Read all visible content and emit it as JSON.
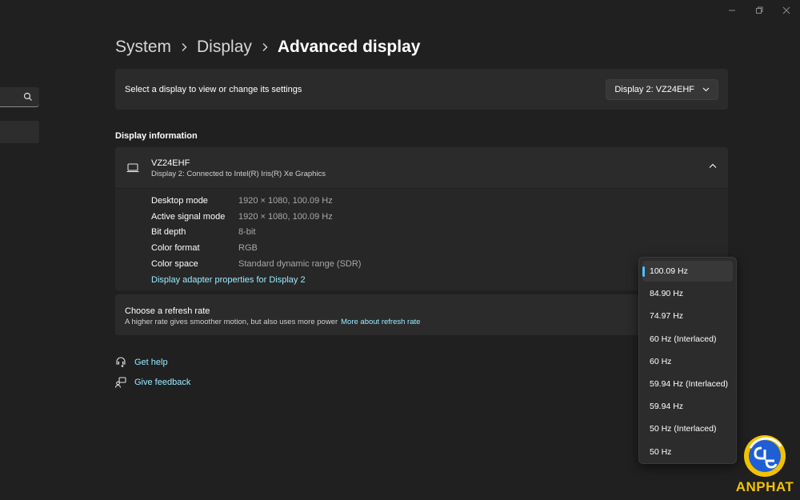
{
  "breadcrumb": {
    "items": [
      "System",
      "Display",
      "Advanced display"
    ]
  },
  "display_select": {
    "label": "Select a display to view or change its settings",
    "selected": "Display 2: VZ24EHF"
  },
  "display_information": {
    "section_title": "Display information",
    "monitor_name": "VZ24EHF",
    "monitor_sub": "Display 2: Connected to Intel(R) Iris(R) Xe Graphics",
    "rows": [
      {
        "key": "Desktop mode",
        "value": "1920 × 1080, 100.09 Hz"
      },
      {
        "key": "Active signal mode",
        "value": "1920 × 1080, 100.09 Hz"
      },
      {
        "key": "Bit depth",
        "value": "8-bit"
      },
      {
        "key": "Color format",
        "value": "RGB"
      },
      {
        "key": "Color space",
        "value": "Standard dynamic range (SDR)"
      }
    ],
    "adapter_link": "Display adapter properties for Display 2"
  },
  "refresh_rate": {
    "title": "Choose a refresh rate",
    "description": "A higher rate gives smoother motion, but also uses more power",
    "link": "More about refresh rate",
    "options": [
      "100.09 Hz",
      "84.90 Hz",
      "74.97 Hz",
      "60 Hz (Interlaced)",
      "60 Hz",
      "59.94 Hz (Interlaced)",
      "59.94 Hz",
      "50 Hz (Interlaced)",
      "50 Hz"
    ],
    "selected_index": 0
  },
  "help": {
    "get_help": "Get help",
    "give_feedback": "Give feedback"
  },
  "logo": {
    "text": "ANPHAT"
  },
  "colors": {
    "accent": "#4cc2ff",
    "link": "#99ebff",
    "background": "#202020",
    "card": "#2b2b2b",
    "logo": "#f2c200"
  }
}
